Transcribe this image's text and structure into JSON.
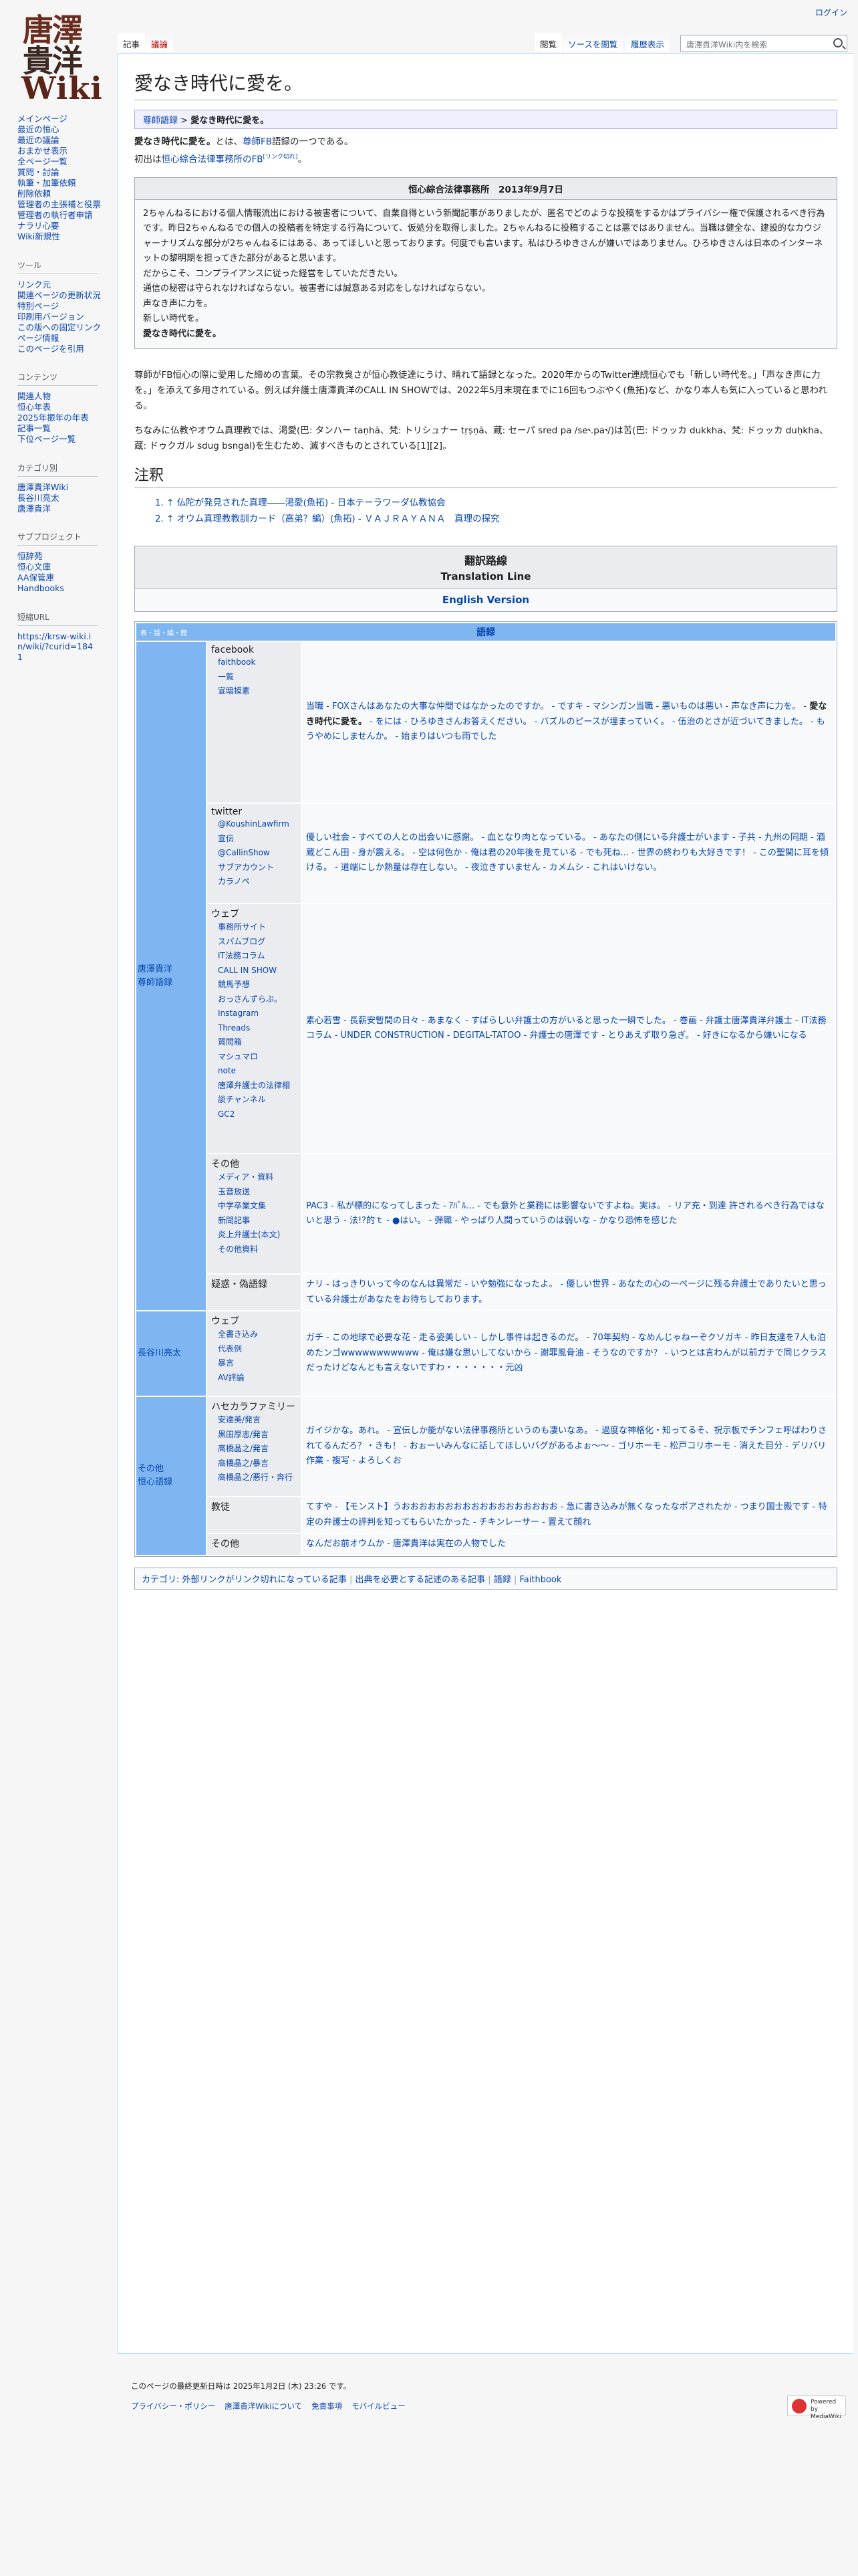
{
  "login": "ログイン",
  "logo": {
    "line1": "唐澤",
    "line2": "貴洋",
    "line3": "Wiki"
  },
  "sidebar": {
    "nav": [
      "メインページ",
      "最近の恒心",
      "最近の議論",
      "おまかせ表示",
      "全ページ一覧",
      "質問・討論",
      "執筆・加筆依頼",
      "削除依頼",
      "管理者の主張補と役票",
      "管理者の執行者申請",
      "ナラリ心要",
      "Wiki新規性"
    ],
    "tools_title": "ツール",
    "tools": [
      "リンク元",
      "関連ページの更新状況",
      "特別ページ",
      "印刷用バージョン",
      "この版への固定リンク",
      "ページ情報",
      "このページを引用"
    ],
    "contents_title": "コンテンツ",
    "contents": [
      "関連人物",
      "恒心年表",
      "2025年振年の年表",
      "記事一覧",
      "下位ページ一覧"
    ],
    "category_title": "カテゴリ別",
    "category": [
      "唐澤貴洋Wiki",
      "長谷川亮太",
      "唐澤貴洋"
    ],
    "sub_title": "サブプロジェクト",
    "sub": [
      "恒辞苑",
      "恒心文庫",
      "AA保管庫",
      "Handbooks"
    ],
    "short_title": "短縮URL",
    "short": [
      "https://krsw-wiki.in/wiki/?curid=1841"
    ]
  },
  "tabs": {
    "article": "記事",
    "talk": "議論",
    "read": "閲覧",
    "source": "ソースを閲覧",
    "history": "履歴表示",
    "search_placeholder": "唐澤貴洋Wiki内を検索"
  },
  "page": {
    "title": "愛なき時代に愛を。",
    "bread_link": "尊師語録",
    "bread_sep": " > ",
    "bread_cur": "愛なき時代に愛を。",
    "intro_bold": "愛なき時代に愛を。",
    "intro_mid": "とは、",
    "intro_link": "尊師FB",
    "intro_end": "語録の一つである。",
    "first_pre": "初出は",
    "first_link": "恒心綜合法律事務所のFB",
    "first_sup": "[リンク切れ]",
    "first_end": "。",
    "notice_title": "恒心綜合法律事務所　2013年9月7日",
    "notice_lines": [
      "2ちゃんねるにおける個人情報流出における被害者について、自業自得という新聞記事がありましたが、匿名でどのような投稿をするかはプライバシー権で保護されるべき行為です。昨日2ちゃんねるでの個人の投稿者を特定する行為について、仮処分を取得しました。2ちゃんねるに投稿することは悪ではありません。当職は健全な、建設的なカウジャーナリズムな部分が2ちゃんねるにはある、あってほしいと思っております。何度でも言います。私はひろゆきさんが嫌いではありません。ひろゆきさんは日本のインターネットの黎明期を担ってきた部分があると思います。",
      "だからこそ、コンプライアンスに従った経営をしていただきたい。",
      "通信の秘密は守られなければならない。被害者には誠意ある対応をしなければならない。",
      "声なき声に力を。",
      "新しい時代を。"
    ],
    "notice_last": "愛なき時代に愛を。",
    "p1": "尊師がFB恒心の際に愛用した締めの言葉。その宗教臭さが恒心教徒達にうけ、晴れて語録となった。2020年からのTwitter連続恒心でも「新しい時代を。」「声なき声に力を。」を添えて多用されている。例えば弁護士唐澤貴洋のCALL IN SHOWでは、2022年5月末現在までに16回もつぶやく(魚拓)など、かなり本人も気に入っていると思われる。",
    "p2": "ちなみに仏教やオウム真理教では、渇愛(巴: タンハー taṇhā、梵: トリシュナー tṛṣṇā、蔵: セーパ sred pa /se˞.pa˞/)は苦(巴: ドゥッカ dukkha、梵: ドゥッカ duḥkha、蔵: ドゥクガル sdug bsngal)を生むため、滅すべきものとされている[1][2]。",
    "notes_title": "注釈",
    "notes": [
      "↑ 仏陀が発見された真理――渇愛(魚拓) - 日本テーラワーダ仏教協会",
      "↑ オウム真理教教訓カード（高弟？編）(魚拓) - ＶＡＪＲＡＹＡＮＡ　真理の探究"
    ],
    "trans_title": "翻訳路線",
    "trans_sub": "Translation Line",
    "trans_link": "English Version",
    "cat_label": "カテゴリ",
    "cat_items": [
      "外部リンクがリンク切れになっている記事",
      "出典を必要とする記述のある記事",
      "語録",
      "Faithbook"
    ]
  },
  "nav": {
    "vte": "表・話・編・歴",
    "title": "語録",
    "group_a": "唐澤貴洋\n尊師語録",
    "fb_title": "facebook",
    "fb_items": [
      "faithbook",
      "一覧",
      "宣暗摸素"
    ],
    "fb_text_a": "当職 - FOXさんはあなたの大事な仲間ではなかったのですか。 - ですキ - マシンガン当職 - 悪いものは悪い - 声なき声に力を。 - ",
    "fb_bold": "愛なき時代に愛を。",
    "fb_text_b": " - をには - ひろゆきさんお答えください。 - バズルのピースが埋まっていく。 - 伍治のとさが近づいてきました。 - もうやめにしませんか。 - 始まりはいつも雨でした",
    "tw_title": "twitter",
    "tw_items": [
      "@KoushinLawfirm",
      "宣伝",
      "@CallinShow",
      "サブアカウント",
      "カラノペ"
    ],
    "tw_text": "優しい社会 - すべての人との出会いに感謝。 - 血となり肉となっている。 - あなたの側にいる弁護士がいます - 子共 - 九州の同期 - 酒蔵どこん田 - 身が震える。 - 空は何色か - 俺は君の20年後を見ている - でも死ね... - 世界の終わりも大好きです！ - この聖関に耳を傾ける。 - 道端にしか熱量は存在しない。 - 夜泣きすいません - カメムシ - これはいけない。",
    "web_title": "ウェブ",
    "web_items": [
      "事務所サイト",
      "スパムブログ",
      "IT法務コラム",
      "CALL IN SHOW",
      "競馬予想",
      "おっさんずらぶ。",
      "Instagram",
      "Threads",
      "質問箱",
      "マシュマロ",
      "note",
      "唐澤弁護士の法律相談チャンネル",
      "GC2"
    ],
    "web_text": "素心若雪 - 長薪安暫間の日々 - あまなく - すばらしい弁護士の方がいると思った一瞬でした。 - 巻画 - 弁護士唐澤貴洋弁護士 - IT法務コラム - UNDER CONSTRUCTION - DEGITAL-TATOO - 弁護士の唐澤です - とりあえず取り急ぎ。 - 好きになるから嫌いになる",
    "etc_title": "その他",
    "etc_items": [
      "メディア・資料",
      "玉音放送",
      "中学卒業文集",
      "新聞記事",
      "炎上弁護士(本文)",
      "その他資料"
    ],
    "etc_text": "PAC3 - 私が標的になってしまった - ｱﾊﾟﾙ... - でも意外と業務には影響ないですよね。実は。 - リア充・到達 許されるべき行為ではないと思う - 法!?的ｔ - ●はい。 - 弾職 - やっぱり人間っていうのは弱いな - かなり恐怖を感じた",
    "fake_title": "疑惑・偽語録",
    "fake_text": "ナリ - はっきりいって今のなんは異常だ - いや勉強になったよ。 - 優しい世界 - あなたの心の一ページに残る弁護士でありたいと思っている弁護士があなたをお待ちしております。",
    "group_b": "長谷川亮太",
    "hs_title": "ウェブ",
    "hs_items": [
      "全書き込み",
      "代表例",
      "暴言",
      "AV評論"
    ],
    "hs_text": "ガチ - この地球で必要な花 - 走る姿美しい - しかし事件は起きるのだ。 - 70年契約 - なめんじゃねーぞクソガキ - 昨日友達を7人も泊めたンゴwwwwwwwwwww - 俺は嫌な思いしてないから - 謝罪風骨油 - そうなのですか？ - いつとは言わんが以前ガチで同じクラスだったけどなんとも言えないですわ・・・・・・・元凶",
    "group_c": "その他\n恒心語録",
    "hf_title": "ハセカラファミリー",
    "hf_items": [
      "安達美/発言",
      "黒田厚志/発言",
      "高橋晶之/発言",
      "高橋晶之/暴言",
      "高橋晶之/悪行・奔行"
    ],
    "hf_text": "ガイジかな。あれ。 - 宣伝しか能がない法律事務所というのも凄いなあ。 - 過度な神格化・知ってるそ、祝示板でチンフェ呼ばわりされてるんだろ？・きも！ - おぉーいみんなに話してほしいバグがあるよぉ〜〜 - ゴリホーモ - 松戸コリホーモ - 消えた目分 - デリバリ作業 - 複写 - よろしくお",
    "gk_title": "教徒",
    "gk_text": "てすや - 【モンスト】うおおおおおおおおおおおおおおおおおお - 急に書き込みが無くなったなポアされたか - つまり国士殿です - 特定の弁護士の評判を知ってもらいたかった - チキンレーサー - 置えて顔れ",
    "ot_title": "その他",
    "ot_text": "なんだお前オウムか - 唐澤貴洋は実在の人物でした"
  },
  "footer": {
    "updated": "このページの最終更新日時は 2025年1月2日 (木) 23:26 です。",
    "links": [
      "プライバシー・ポリシー",
      "唐澤貴洋Wikiについて",
      "免責事項",
      "モバイルビュー"
    ],
    "powered": "Powered by MediaWiki"
  }
}
